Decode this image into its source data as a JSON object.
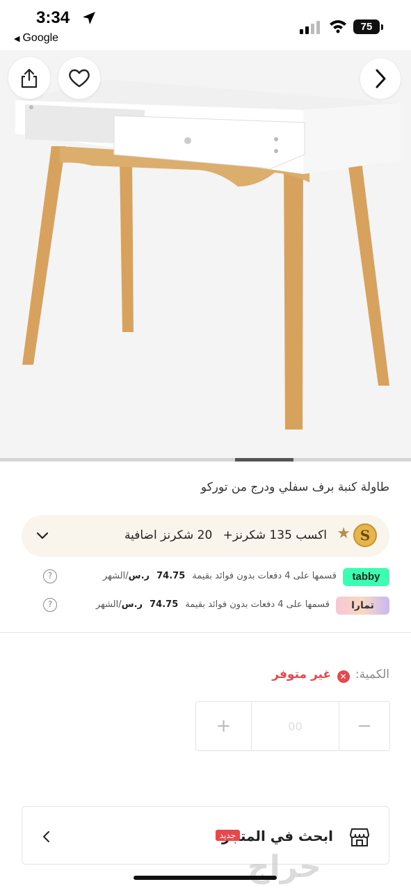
{
  "status_bar": {
    "time": "3:34",
    "back_app": "Google",
    "battery": "75"
  },
  "product": {
    "title": "طاولة كنبة برف سفلي ودرج من توركو",
    "image_alt_icons": [
      "share-icon",
      "heart-icon",
      "chevron-right-icon"
    ]
  },
  "rewards": {
    "earn_text": "اكسب 135 شكرنز+",
    "extra_text": "20 شكرنز اضافية",
    "coin_letter": "S"
  },
  "installments": [
    {
      "provider": "tabby",
      "text": "قسمها على 4 دفعات بدون فوائد بقيمة",
      "amount": "74.75",
      "currency": "ر.س",
      "period": "/الشهر",
      "help": "?"
    },
    {
      "provider": "تمارا",
      "text": "قسمها على 4 دفعات بدون فوائد بقيمة",
      "amount": "74.75",
      "currency": "ر.س",
      "period": "/الشهر",
      "help": "?"
    }
  ],
  "quantity": {
    "label": "الكمية:",
    "status": "غير متوفر",
    "status_icon": "✕",
    "value": "00",
    "plus": "+",
    "minus": "−"
  },
  "store_search": {
    "title": "ابحث في المتجر",
    "badge": "جديد"
  },
  "watermark": "حراج",
  "colors": {
    "accent_red": "#e5484d",
    "tabby_green": "#3bffb0",
    "coin_gold": "#e7b54e",
    "rewards_bg": "#faf5ec"
  }
}
